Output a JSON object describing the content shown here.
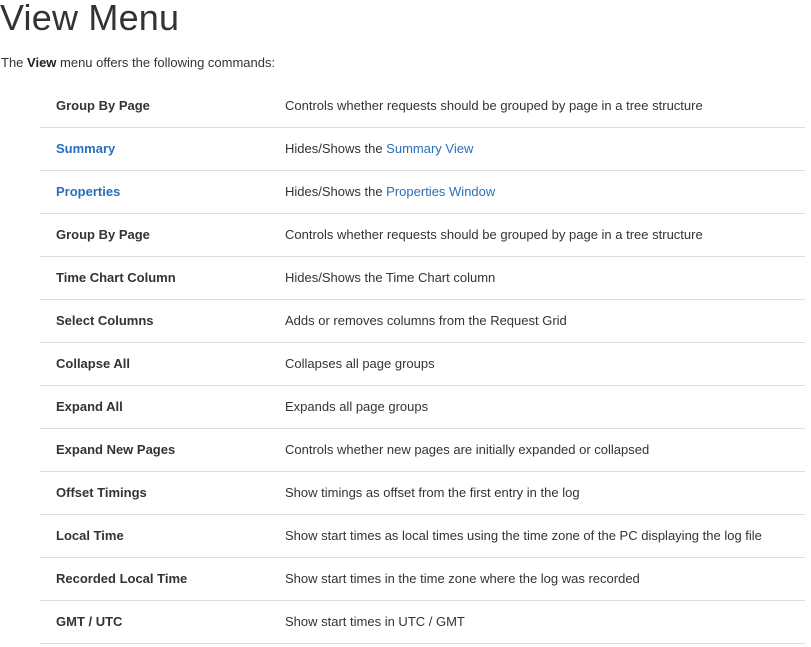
{
  "page": {
    "title": "View Menu",
    "intro_prefix": "The ",
    "intro_bold": "View",
    "intro_suffix": " menu offers the following commands:"
  },
  "colors": {
    "text": "#333333",
    "link": "#2a6ebb",
    "divider": "#dddddd"
  },
  "commands": [
    {
      "name": "Group By Page",
      "is_link": false,
      "desc_text": "Controls whether requests should be grouped by page in a tree structure",
      "desc_link": ""
    },
    {
      "name": "Summary",
      "is_link": true,
      "desc_text": "Hides/Shows the ",
      "desc_link": "Summary View"
    },
    {
      "name": "Properties",
      "is_link": true,
      "desc_text": "Hides/Shows the ",
      "desc_link": "Properties Window"
    },
    {
      "name": "Group By Page",
      "is_link": false,
      "desc_text": "Controls whether requests should be grouped by page in a tree structure",
      "desc_link": ""
    },
    {
      "name": "Time Chart Column",
      "is_link": false,
      "desc_text": "Hides/Shows the Time Chart column",
      "desc_link": ""
    },
    {
      "name": "Select Columns",
      "is_link": false,
      "desc_text": "Adds or removes columns from the Request Grid",
      "desc_link": ""
    },
    {
      "name": "Collapse All",
      "is_link": false,
      "desc_text": "Collapses all page groups",
      "desc_link": ""
    },
    {
      "name": "Expand All",
      "is_link": false,
      "desc_text": "Expands all page groups",
      "desc_link": ""
    },
    {
      "name": "Expand New Pages",
      "is_link": false,
      "desc_text": "Controls whether new pages are initially expanded or collapsed",
      "desc_link": ""
    },
    {
      "name": "Offset Timings",
      "is_link": false,
      "desc_text": "Show timings as offset from the first entry in the log",
      "desc_link": ""
    },
    {
      "name": "Local Time",
      "is_link": false,
      "desc_text": "Show start times as local times using the time zone of the PC displaying the log file",
      "desc_link": ""
    },
    {
      "name": "Recorded Local Time",
      "is_link": false,
      "desc_text": "Show start times in the time zone where the log was recorded",
      "desc_link": ""
    },
    {
      "name": "GMT / UTC",
      "is_link": false,
      "desc_text": "Show start times in UTC / GMT",
      "desc_link": ""
    }
  ]
}
